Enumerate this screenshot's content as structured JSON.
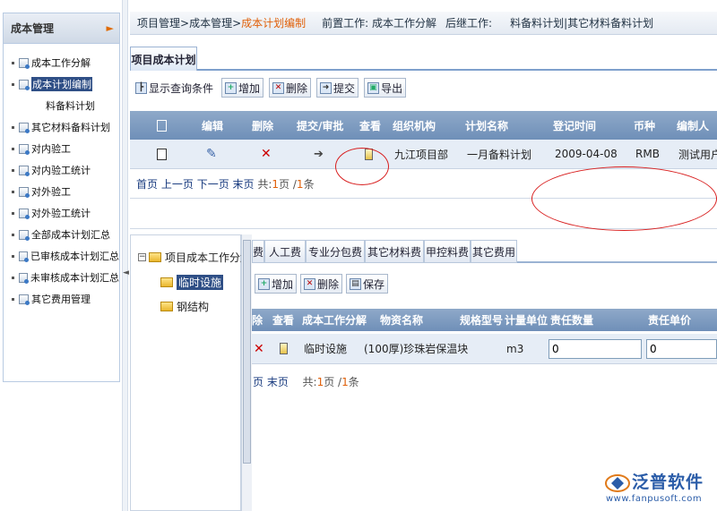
{
  "sidebar": {
    "title": "成本管理",
    "items": [
      {
        "label": "成本工作分解"
      },
      {
        "label": "成本计划编制"
      },
      {
        "label": "料备料计划"
      },
      {
        "label": "其它材料备料计划"
      },
      {
        "label": "对内验工"
      },
      {
        "label": "对内验工统计"
      },
      {
        "label": "对外验工"
      },
      {
        "label": "对外验工统计"
      },
      {
        "label": "全部成本计划汇总"
      },
      {
        "label": "已审核成本计划汇总"
      },
      {
        "label": "未审核成本计划汇总"
      },
      {
        "label": "其它费用管理"
      }
    ]
  },
  "breadcrumb": {
    "path1": "项目管理",
    "sep": " > ",
    "path2": "成本管理",
    "current": "成本计划编制",
    "pre_work": "前置工作: 成本工作分解",
    "post_work": "后继工作:",
    "post_work_items": "料备料计划|其它材料备料计划"
  },
  "main_tab": "项目成本计划",
  "toolbar": {
    "show_query": "显示查询条件",
    "add": "增加",
    "delete": "删除",
    "submit": "提交",
    "export": "导出"
  },
  "grid1": {
    "headers": [
      "编辑",
      "删除",
      "提交/审批",
      "查看",
      "组织机构",
      "计划名称",
      "登记时间",
      "币种",
      "编制人"
    ],
    "row": {
      "org": "九江项目部",
      "plan_name": "一月备料计划",
      "date": "2009-04-08",
      "currency": "RMB",
      "creator": "测试用户"
    },
    "pager": {
      "first": "首页",
      "prev": "上一页",
      "next": "下一页",
      "last": "末页",
      "total_prefix": "共:",
      "page": "1",
      "page_unit": "页 /",
      "count": "1",
      "count_unit": "条"
    }
  },
  "tree": {
    "root": "项目成本工作分解",
    "children": [
      "临时设施",
      "钢结构"
    ]
  },
  "lower_tabs": [
    "费",
    "人工费",
    "专业分包费",
    "其它材料费",
    "甲控料费",
    "其它费用"
  ],
  "toolbar2": {
    "add": "增加",
    "delete": "删除",
    "save": "保存"
  },
  "grid2": {
    "headers": [
      "除",
      "查看",
      "成本工作分解",
      "物资名称",
      "规格型号",
      "计量单位",
      "责任数量",
      "责任单价"
    ],
    "row": {
      "wbs": "临时设施",
      "material": "(100厚)珍珠岩保温块",
      "unit": "m3",
      "qty": "0",
      "price": "0"
    },
    "pager": {
      "prev_tail": "页",
      "last": "末页",
      "total_prefix": "共:",
      "page": "1",
      "page_unit": "页 /",
      "count": "1",
      "count_unit": "条"
    }
  },
  "logo": {
    "name": "泛普软件",
    "url": "www.fanpusoft.com"
  },
  "colors": {
    "accent_orange": "#e0600a",
    "header_blue": "#7f9cc4",
    "selection": "#2f4f86",
    "annotation_red": "#d81e1e"
  }
}
